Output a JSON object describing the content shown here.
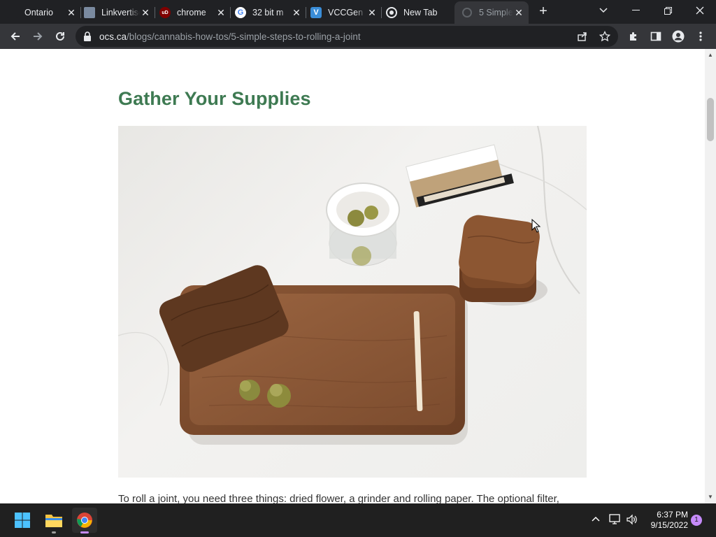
{
  "tabs": [
    {
      "title": "Ontario",
      "icon": "ontario-cannabis-favicon"
    },
    {
      "title": "Linkvertise",
      "icon": "linkvertise-favicon"
    },
    {
      "title": "chrome",
      "icon": "ublock-favicon"
    },
    {
      "title": "32 bit m",
      "icon": "google-favicon"
    },
    {
      "title": "VCCGen",
      "icon": "vccgen-favicon"
    },
    {
      "title": "New Tab",
      "icon": "chrome-favicon"
    },
    {
      "title": "5 Simple",
      "icon": "loading-favicon",
      "active": true
    }
  ],
  "address": {
    "host": "ocs.ca",
    "path": "/blogs/cannabis-how-tos/5-simple-steps-to-rolling-a-joint"
  },
  "page": {
    "heading": "Gather Your Supplies",
    "photo_subject": "rolling-supplies-photo",
    "body_text": "To roll a joint, you need three things: dried flower, a grinder and rolling paper. The optional filter,"
  },
  "taskbar": {
    "time": "6:37 PM",
    "date": "9/15/2022",
    "notification_count": "1"
  },
  "colors": {
    "heading": "#3e7a52",
    "tab_bg": "#202124",
    "toolbar_bg": "#35363a"
  }
}
